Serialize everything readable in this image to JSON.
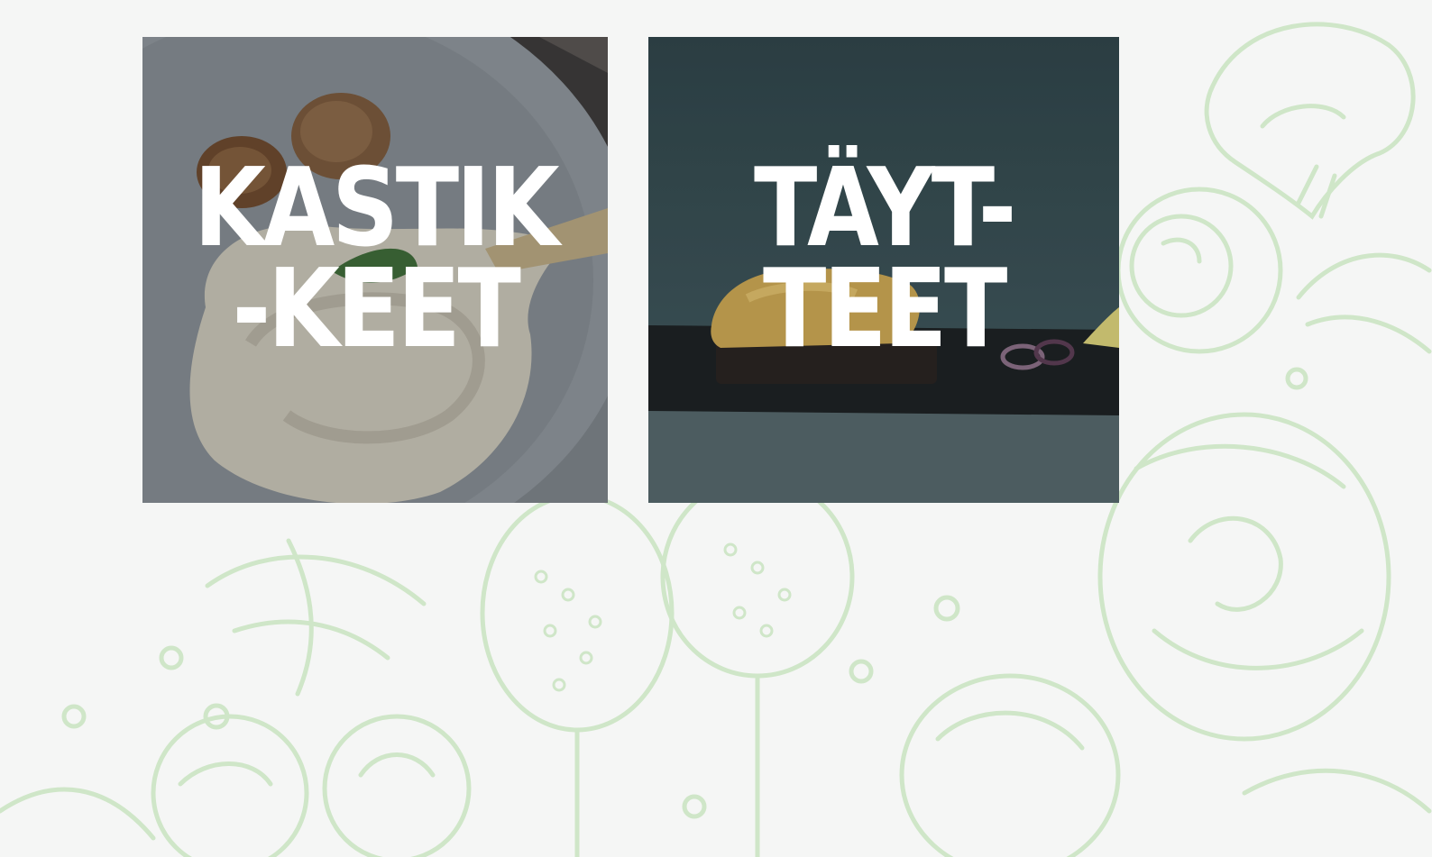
{
  "cards": [
    {
      "line1": "KASTIK",
      "line2": "-KEET",
      "image": "sauce-photo"
    },
    {
      "line1": "TÄYT-",
      "line2": "TEET",
      "image": "filling-photo"
    }
  ],
  "colors": {
    "background": "#f5f6f5",
    "doodle": "#cfe6c8",
    "title": "#ffffff"
  }
}
